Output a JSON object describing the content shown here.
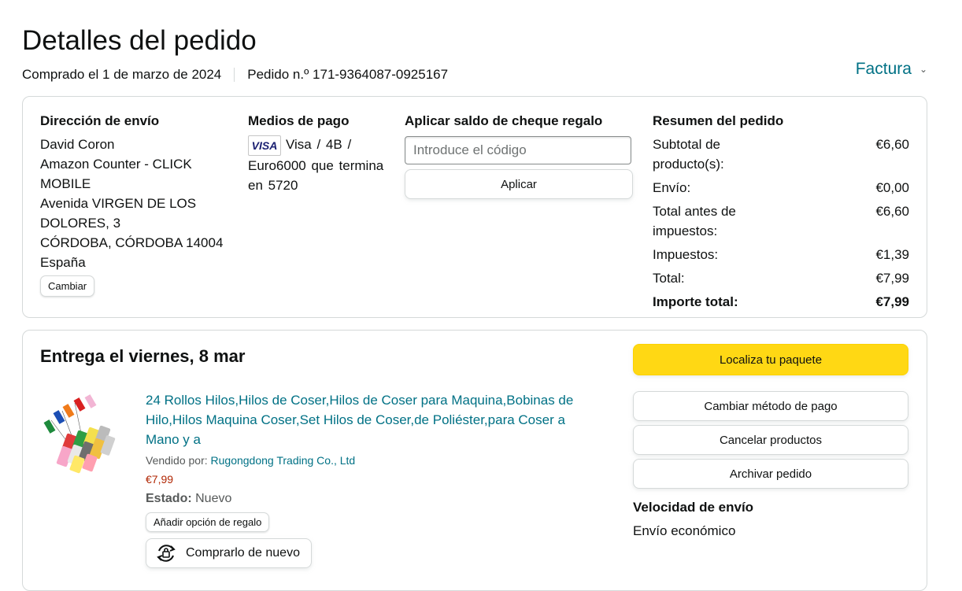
{
  "page_title": "Detalles del pedido",
  "order_meta": {
    "date": "Comprado el 1 de marzo de 2024",
    "number": "Pedido n.º 171-9364087-0925167"
  },
  "invoice_label": "Factura",
  "shipping": {
    "heading": "Dirección de envío",
    "lines": [
      "David Coron",
      "Amazon Counter - CLICK MOBILE",
      "Avenida VIRGEN DE LOS DOLORES, 3",
      "CÓRDOBA, CÓRDOBA 14004",
      "España"
    ],
    "change_label": "Cambiar"
  },
  "payment": {
    "heading": "Medios de pago",
    "card_logo": "VISA",
    "text": "Visa / 4B / Euro6000 que termina en 5720"
  },
  "gift_card": {
    "heading": "Aplicar saldo de cheque regalo",
    "placeholder": "Introduce el código",
    "apply_label": "Aplicar"
  },
  "summary": {
    "heading": "Resumen del pedido",
    "rows": [
      {
        "label": "Subtotal de producto(s):",
        "value": "€6,60"
      },
      {
        "label": "Envío:",
        "value": "€0,00"
      },
      {
        "label": "Total antes de impuestos:",
        "value": "€6,60"
      },
      {
        "label": "Impuestos:",
        "value": "€1,39"
      },
      {
        "label": "Total:",
        "value": "€7,99"
      },
      {
        "label": "Importe total:",
        "value": "€7,99"
      }
    ]
  },
  "delivery": {
    "title": "Entrega el viernes, 8 mar",
    "product": {
      "title": "24 Rollos Hilos,Hilos de Coser,Hilos de Coser para Maquina,Bobinas de Hilo,Hilos Maquina Coser,Set Hilos de Coser,de Poliéster,para Coser a Mano y a",
      "sold_by_label": "Vendido por:",
      "seller": "Rugongdong Trading Co., Ltd",
      "price": "€7,99",
      "state_label": "Estado:",
      "state_value": "Nuevo",
      "gift_option_label": "Añadir opción de regalo",
      "rebuy_label": "Comprarlo de nuevo"
    },
    "actions": {
      "track": "Localiza tu paquete",
      "change_payment": "Cambiar método de pago",
      "cancel": "Cancelar productos",
      "archive": "Archivar pedido"
    },
    "speed_heading": "Velocidad de envío",
    "speed_value": "Envío económico"
  },
  "colors": {
    "link": "#007185",
    "primary_button": "#ffd814",
    "price": "#b12704",
    "border": "#d5d9d9"
  }
}
